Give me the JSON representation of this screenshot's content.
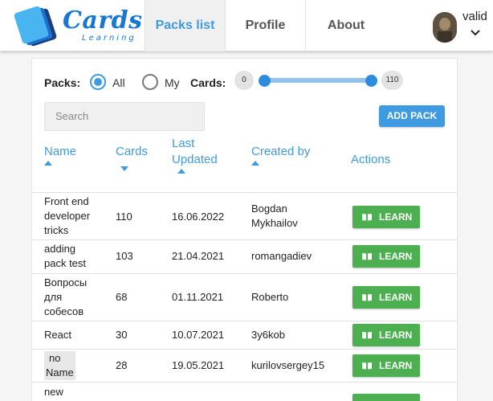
{
  "app": {
    "logo_title": "Cards",
    "logo_subtitle": "Learning"
  },
  "nav": {
    "tabs": [
      {
        "label": "Packs list",
        "active": true
      },
      {
        "label": "Profile",
        "active": false
      },
      {
        "label": "About",
        "active": false
      }
    ],
    "user_name": "valid"
  },
  "filters": {
    "packs_label": "Packs:",
    "options": [
      {
        "label": "All",
        "checked": true
      },
      {
        "label": "My",
        "checked": false
      }
    ],
    "cards_label": "Cards:",
    "cards_min": "0",
    "cards_max": "110"
  },
  "search": {
    "placeholder": "Search",
    "value": ""
  },
  "add_pack_label": "ADD PACK",
  "table": {
    "headers": {
      "name": "Name",
      "cards": "Cards",
      "last_updated_1": "Last",
      "last_updated_2": "Updated",
      "created_by": "Created by",
      "actions": "Actions"
    },
    "learn_label": "LEARN",
    "rows": [
      {
        "name": [
          "Front end",
          "developer",
          "tricks"
        ],
        "cards": "110",
        "updated": "16.06.2022",
        "created": [
          "Bogdan",
          "Mykhailov"
        ]
      },
      {
        "name": [
          "adding",
          "pack test"
        ],
        "cards": "103",
        "updated": "21.04.2021",
        "created": [
          "romangadiev"
        ]
      },
      {
        "name": [
          "Вопросы",
          "для",
          "собесов"
        ],
        "cards": "68",
        "updated": "01.11.2021",
        "created": [
          "Roberto"
        ]
      },
      {
        "name": [
          "React"
        ],
        "cards": "30",
        "updated": "10.07.2021",
        "created": [
          "3y6kob"
        ]
      },
      {
        "name": [
          "no",
          "Name"
        ],
        "cards": "28",
        "updated": "19.05.2021",
        "created": [
          "kurilovsergey15"
        ]
      },
      {
        "name": [
          "new"
        ],
        "cards": "",
        "updated": "",
        "created": [
          ""
        ]
      }
    ]
  },
  "colors": {
    "accent": "#3f9ae0",
    "learn_button": "#4caf50",
    "brand": "#1976d2"
  }
}
